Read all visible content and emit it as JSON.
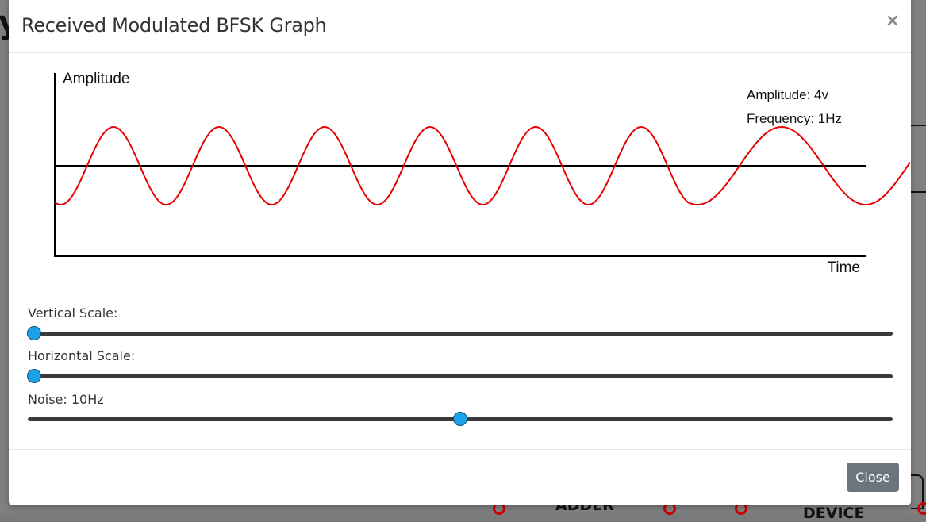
{
  "modal": {
    "title": "Received Modulated BFSK Graph",
    "close_icon": "×",
    "close_label": "Close"
  },
  "graph": {
    "y_axis_label": "Amplitude",
    "x_axis_label": "Time",
    "amplitude_text": "Amplitude: 4v",
    "frequency_text": "Frequency: 1Hz",
    "wave_color": "#e60000",
    "axis_color": "#000000"
  },
  "controls": {
    "vertical_scale": {
      "label": "Vertical Scale:",
      "fraction": 0.0
    },
    "horizontal_scale": {
      "label": "Horizontal Scale:",
      "fraction": 0.0
    },
    "noise": {
      "label": "Noise: 10Hz",
      "fraction": 0.5
    }
  },
  "colors": {
    "slider_thumb": "#1aa3e8",
    "slider_track": "#3a3a3a",
    "close_button": "#6c757d"
  },
  "background": {
    "fragment_letter": "y",
    "fragment_adder": "ADDER",
    "fragment_device": "DEVICE"
  }
}
